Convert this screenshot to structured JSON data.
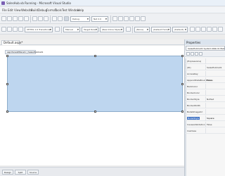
{
  "window": {
    "title": "SalesHub.vb Running - Microsoft Visual Studio"
  },
  "menu": [
    "File",
    "Edit",
    "View",
    "Website",
    "Build",
    "Debug",
    "Format",
    "Tools",
    "Test",
    "Window",
    "Help"
  ],
  "toolbar": {
    "configuration": "Debug",
    "platform": "Net 2.0",
    "doctype": "XHTML 1.0 Transitional",
    "style_application": "Manual",
    "target_rule": "Target Rule",
    "new_inline_style": "(New Inline Style)",
    "block_format": "(None)",
    "font_name": "(Default Font)",
    "font_size": "(Default)"
  },
  "editor": {
    "tab_label": "Default.aspx*",
    "panel_header": "asp:Panel#Panel1 | SalesHubCall1"
  },
  "statusbar": {
    "tabs": [
      "Design",
      "Split",
      "Source"
    ]
  },
  "properties": {
    "title": "Properties",
    "selected_object": "SalesHubCall1  System.Web.UI.WebControls.Panel",
    "rows": [
      {
        "name": "(Expressions)",
        "value": ""
      },
      {
        "name": "(ID)",
        "value": "SalesHubCall1"
      },
      {
        "name": "AccessKey",
        "value": ""
      },
      {
        "name": "AppendDataBoundItems",
        "value": "False"
      },
      {
        "name": "BackColor",
        "value": ""
      },
      {
        "name": "BorderColor",
        "value": ""
      },
      {
        "name": "BorderStyle",
        "value": "NotSet"
      },
      {
        "name": "BorderWidth",
        "value": ""
      },
      {
        "name": "BulletImageUrl",
        "value": ""
      },
      {
        "name": "BulletStyle",
        "value": "Square"
      },
      {
        "name": "CausesValidation",
        "value": "False"
      },
      {
        "name": "CssClass",
        "value": ""
      }
    ]
  }
}
